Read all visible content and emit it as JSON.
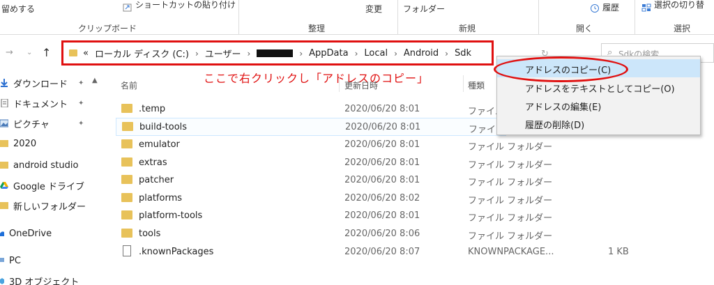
{
  "ribbon": {
    "pin_label": "留めする",
    "shortcut_paste": "ショートカットの貼り付け",
    "rename": "変更",
    "new_folder": "フォルダー",
    "history": "履歴",
    "select_toggle": "選択の切り替",
    "groups": {
      "clipboard": "クリップボード",
      "organize": "整理",
      "new": "新規",
      "open": "開く",
      "select": "選択"
    }
  },
  "address": {
    "overflow": "«",
    "crumbs": [
      "ローカル ディスク (C:)",
      "ユーザー",
      "AppData",
      "Local",
      "Android",
      "Sdk"
    ],
    "chevron": "›"
  },
  "search": {
    "placeholder": "Sdkの検索"
  },
  "annotation": "ここで右クリックし「アドレスのコピー」",
  "sidebar": {
    "items": [
      {
        "label": "ダウンロード",
        "icon": "download-arrow-icon",
        "pinned": true
      },
      {
        "label": "ドキュメント",
        "icon": "document-icon",
        "pinned": true
      },
      {
        "label": "ピクチャ",
        "icon": "picture-icon",
        "pinned": true
      },
      {
        "label": "2020",
        "icon": "folder-icon",
        "pinned": false
      },
      {
        "label": "android studio",
        "icon": "folder-icon",
        "pinned": false
      },
      {
        "label": "Google ドライブ",
        "icon": "google-drive-icon",
        "pinned": false
      },
      {
        "label": "新しいフォルダー",
        "icon": "folder-icon",
        "pinned": false
      },
      {
        "label": "OneDrive",
        "icon": "cloud-icon",
        "pinned": false
      },
      {
        "label": "PC",
        "icon": "pc-icon",
        "pinned": false
      },
      {
        "label": "3D オブジェクト",
        "icon": "cube-icon",
        "pinned": false
      }
    ],
    "pin_glyph": "✦"
  },
  "columns": {
    "name": "名前",
    "date": "更新日時",
    "type": "種類",
    "size": ""
  },
  "files": [
    {
      "name": ".temp",
      "date": "2020/06/20 8:01",
      "type": "ファイル フォルダー",
      "size": "",
      "kind": "folder"
    },
    {
      "name": "build-tools",
      "date": "2020/06/20 8:01",
      "type": "ファイル フォルダー",
      "size": "",
      "kind": "folder"
    },
    {
      "name": "emulator",
      "date": "2020/06/20 8:01",
      "type": "ファイル フォルダー",
      "size": "",
      "kind": "folder"
    },
    {
      "name": "extras",
      "date": "2020/06/20 8:01",
      "type": "ファイル フォルダー",
      "size": "",
      "kind": "folder"
    },
    {
      "name": "patcher",
      "date": "2020/06/20 8:01",
      "type": "ファイル フォルダー",
      "size": "",
      "kind": "folder"
    },
    {
      "name": "platforms",
      "date": "2020/06/20 8:02",
      "type": "ファイル フォルダー",
      "size": "",
      "kind": "folder"
    },
    {
      "name": "platform-tools",
      "date": "2020/06/20 8:01",
      "type": "ファイル フォルダー",
      "size": "",
      "kind": "folder"
    },
    {
      "name": "tools",
      "date": "2020/06/20 8:06",
      "type": "ファイル フォルダー",
      "size": "",
      "kind": "folder"
    },
    {
      "name": ".knownPackages",
      "date": "2020/06/20 8:07",
      "type": "KNOWNPACKAGE...",
      "size": "1 KB",
      "kind": "file"
    }
  ],
  "context_menu": {
    "items": [
      {
        "label": "アドレスのコピー(C)",
        "highlighted": true
      },
      {
        "label": "アドレスをテキストとしてコピー(O)",
        "highlighted": false
      },
      {
        "label": "アドレスの編集(E)",
        "highlighted": false
      },
      {
        "label": "履歴の削除(D)",
        "highlighted": false
      }
    ]
  },
  "colors": {
    "accent_red": "#e01010",
    "folder": "#e8c25a",
    "menu_highlight": "#cce6fa"
  }
}
